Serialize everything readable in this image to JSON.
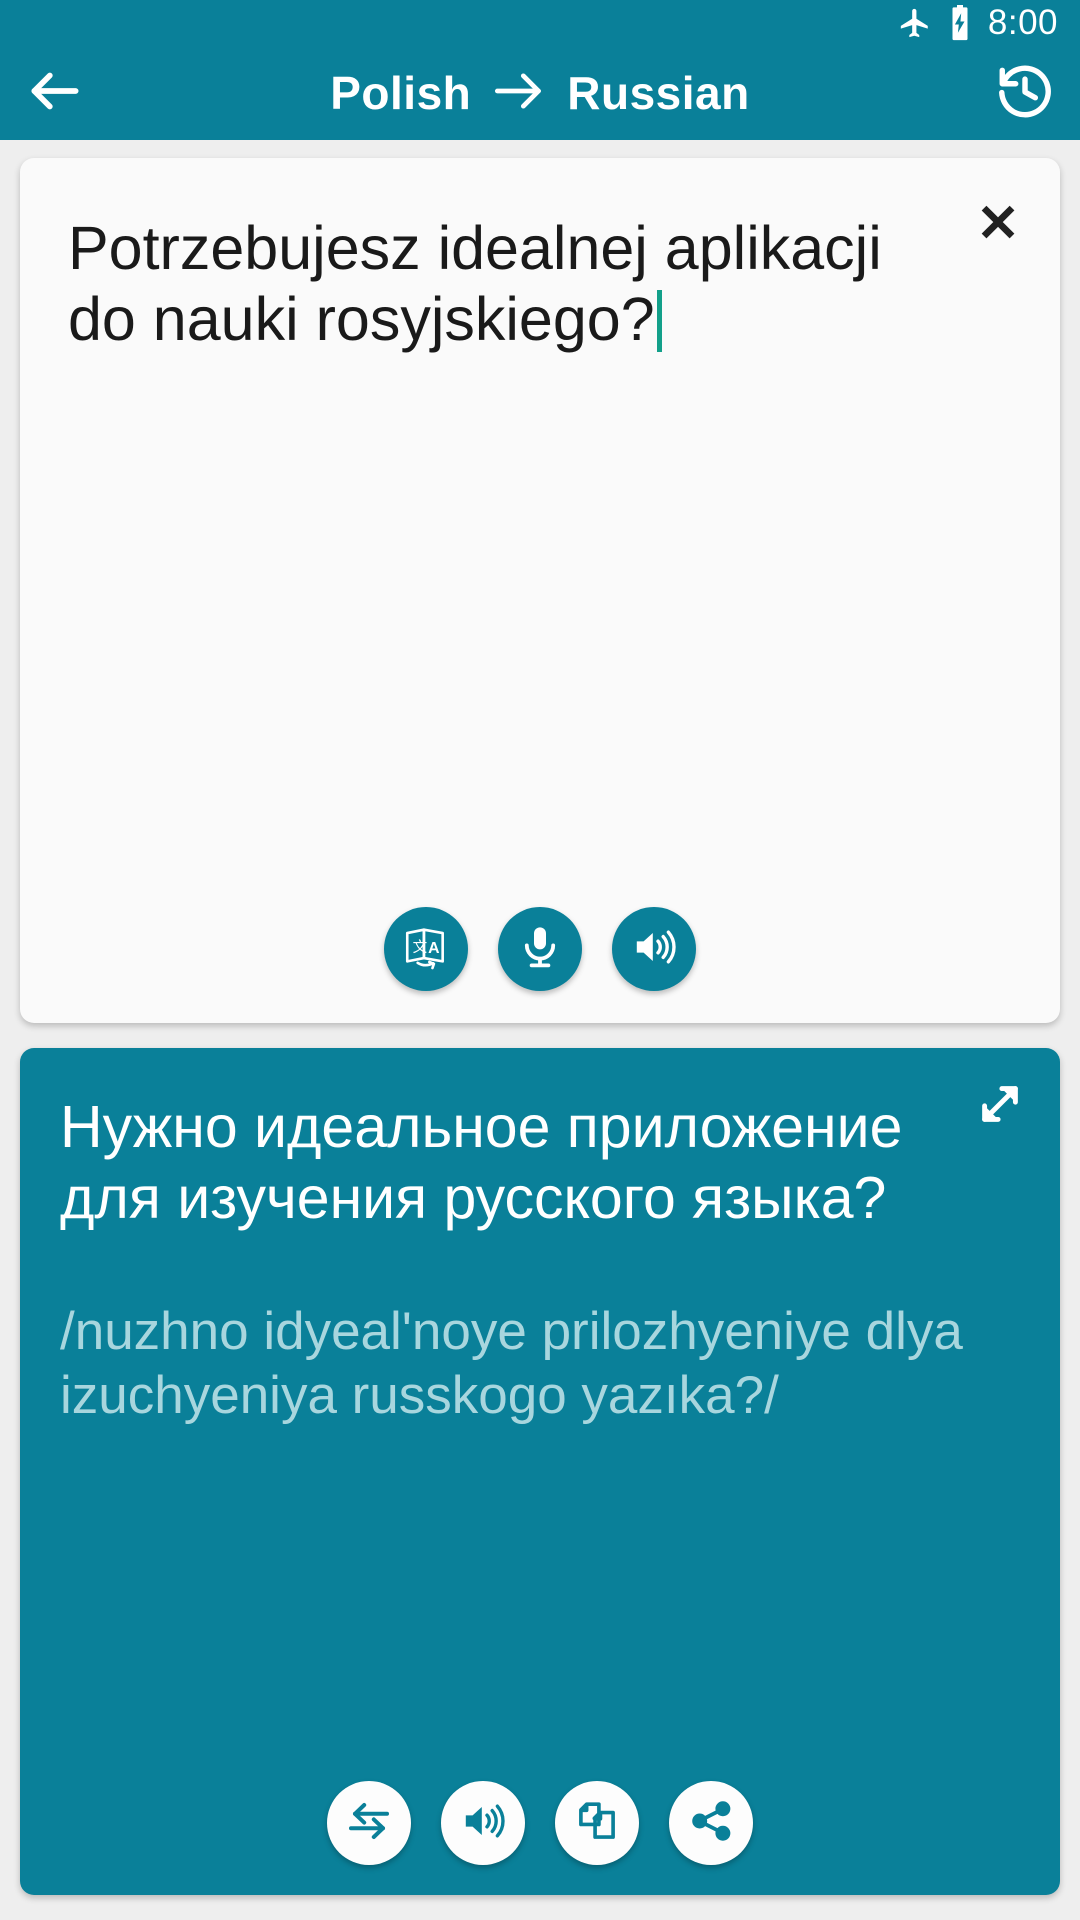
{
  "status_bar": {
    "airplane_icon": "airplane-mode-icon",
    "battery_icon": "battery-charging-icon",
    "time": "8:00"
  },
  "app_bar": {
    "back_icon": "back-arrow-icon",
    "source_language": "Polish",
    "arrow": "→",
    "target_language": "Russian",
    "history_icon": "history-icon"
  },
  "source_card": {
    "close_icon": "✕",
    "text": "Potrzebujesz idealnej aplikacji do nauki rosyjskiego?",
    "actions": [
      {
        "name": "translate-button",
        "icon": "translate-icon"
      },
      {
        "name": "microphone-button",
        "icon": "microphone-icon"
      },
      {
        "name": "speak-source-button",
        "icon": "speaker-icon"
      }
    ]
  },
  "target_card": {
    "expand_icon": "expand-fullscreen-icon",
    "translation": "Нужно идеальное приложение для изучения русского языка?",
    "transliteration": "/nuzhno idyeal'noye prilozhyeniye dlya izuchyeniya russkogo yazıka?/",
    "actions": [
      {
        "name": "swap-languages-button",
        "icon": "swap-arrows-icon"
      },
      {
        "name": "speak-translation-button",
        "icon": "speaker-icon"
      },
      {
        "name": "copy-button",
        "icon": "copy-icon"
      },
      {
        "name": "share-button",
        "icon": "share-icon"
      }
    ]
  },
  "colors": {
    "primary_teal": "#0a8099",
    "page_background": "#eeeeee",
    "card_background": "#fafafa",
    "translit_text": "#a8d6de",
    "caret": "#12a08a"
  }
}
